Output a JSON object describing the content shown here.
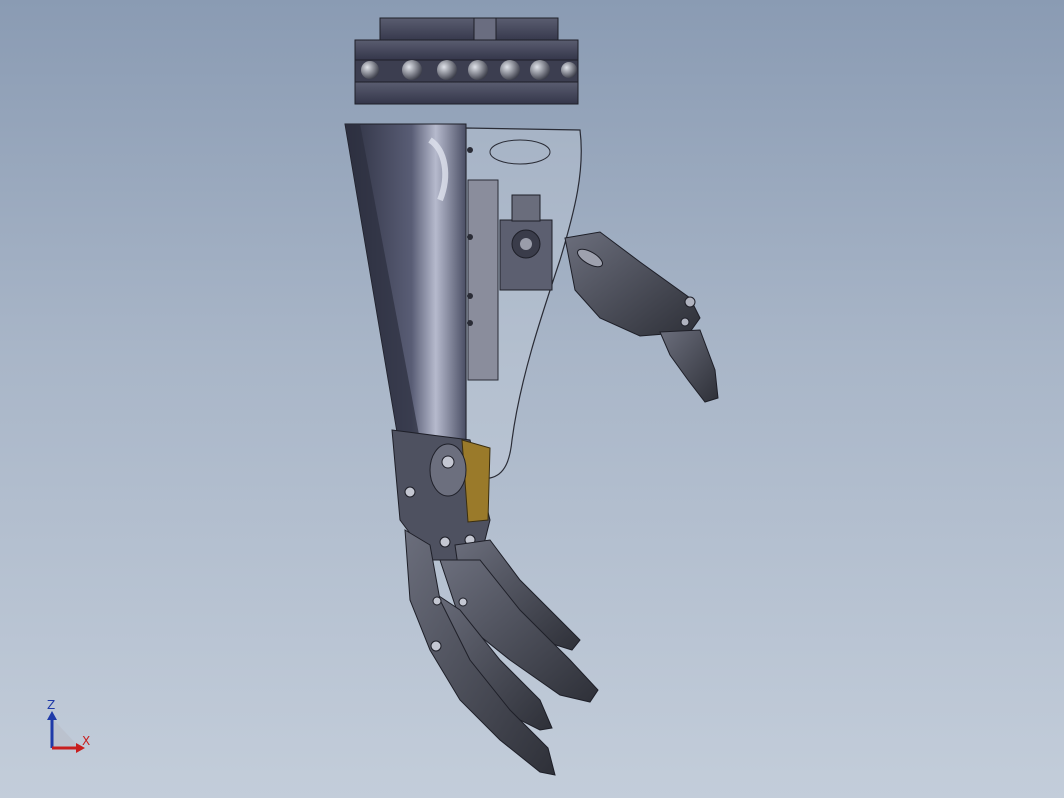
{
  "viewport": {
    "background_top": "#8a9bb3",
    "background_bottom": "#c3cdda",
    "model_description": "robotic-prosthetic-arm"
  },
  "triad": {
    "z_label": "Z",
    "x_label": "X",
    "z_color": "#1f3aa8",
    "x_color": "#c81e1e"
  },
  "colors": {
    "shell_dark": "#3b3f52",
    "shell_mid": "#5a5f76",
    "shell_light": "#8c90a8",
    "cap": "#4a4d5e",
    "finger": "#4c4f5c",
    "brass": "#9a7a2a",
    "transparent_shell": "#c9d1de"
  }
}
